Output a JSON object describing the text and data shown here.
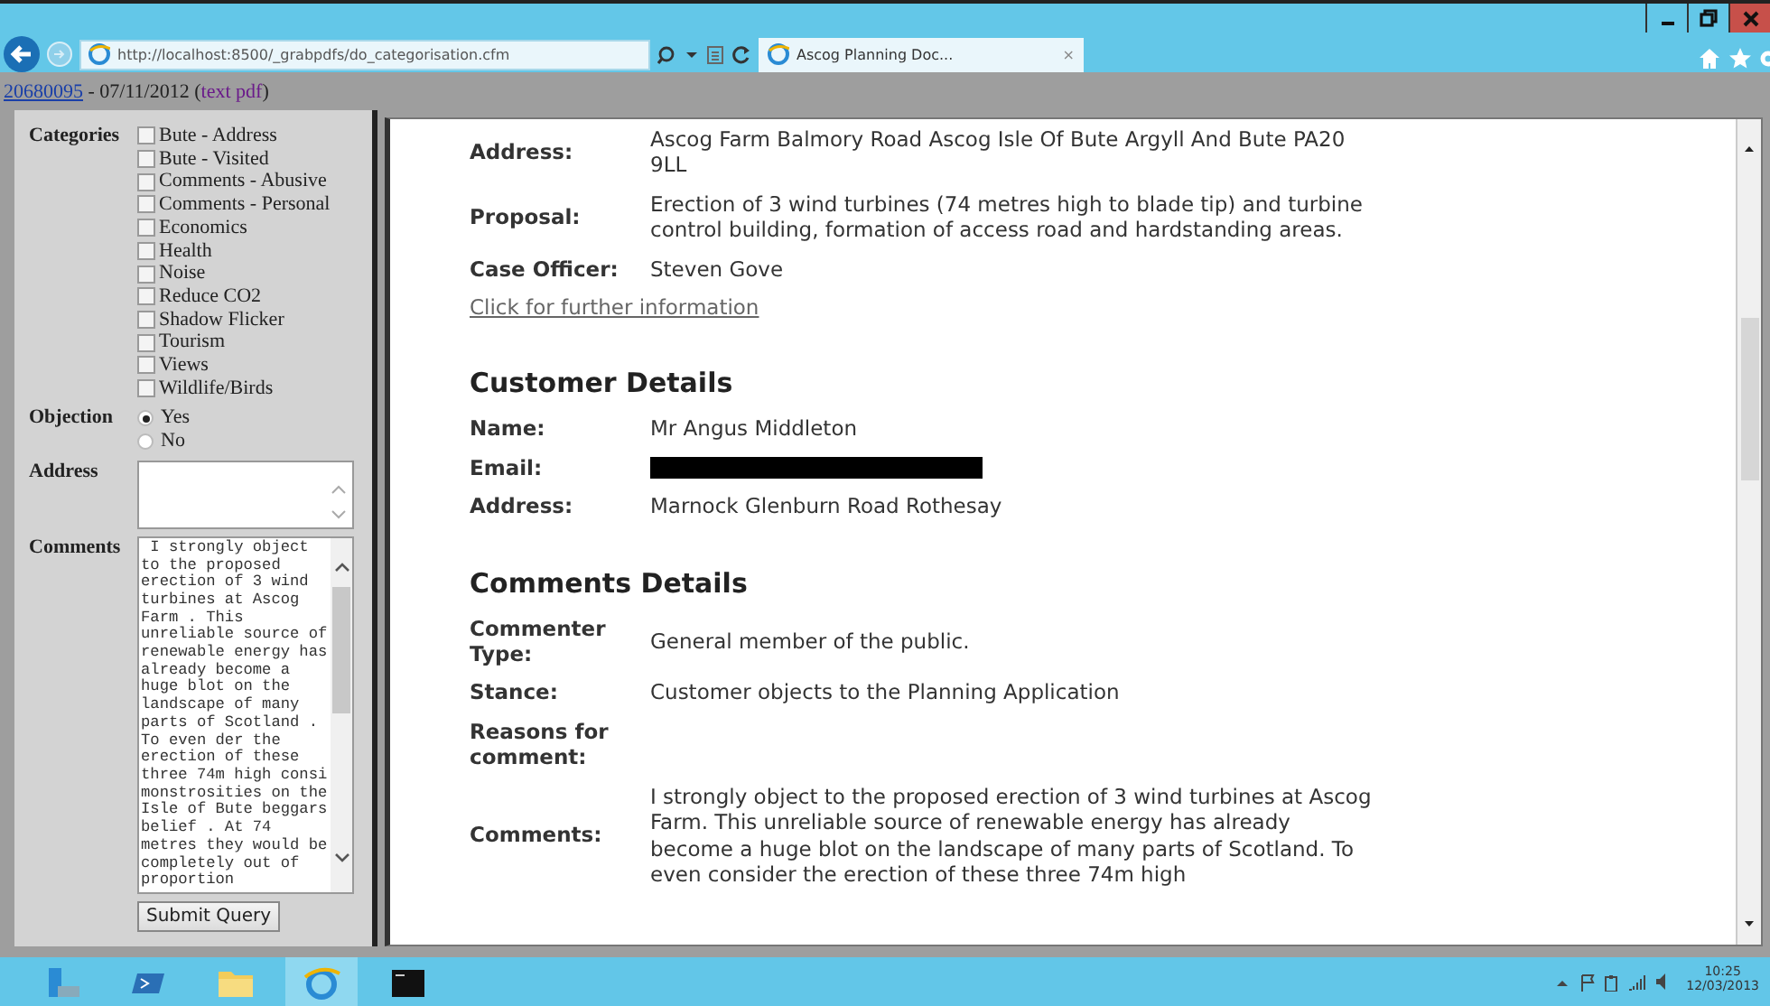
{
  "browser": {
    "url": "http://localhost:8500/_grabpdfs/do_categorisation.cfm",
    "tab": {
      "title": "Ascog Planning Doc...",
      "close": "×",
      "selected": true
    }
  },
  "record_line": [
    {
      "kind": "link",
      "text": "20680095"
    },
    {
      "kind": "text",
      "text": " - 07/11/2012 ("
    },
    {
      "kind": "visited_link",
      "text": "text pdf"
    },
    {
      "kind": "text",
      "text": ")"
    }
  ],
  "form": {
    "categories": {
      "label": "Categories",
      "items": [
        {
          "label": "Bute - Address",
          "checked": false
        },
        {
          "label": "Bute - Visited",
          "checked": false
        },
        {
          "label": "Comments - Abusive",
          "checked": false
        },
        {
          "label": "Comments - Personal",
          "checked": false
        },
        {
          "label": "Economics",
          "checked": false
        },
        {
          "label": "Health",
          "checked": false
        },
        {
          "label": "Noise",
          "checked": false
        },
        {
          "label": "Reduce CO2",
          "checked": false
        },
        {
          "label": "Shadow Flicker",
          "checked": false
        },
        {
          "label": "Tourism",
          "checked": false
        },
        {
          "label": "Views",
          "checked": false
        },
        {
          "label": "Wildlife/Birds",
          "checked": false
        }
      ]
    },
    "objection": {
      "label": "Objection",
      "options": [
        {
          "label": "Yes",
          "selected": true
        },
        {
          "label": "No",
          "selected": false
        }
      ]
    },
    "address": {
      "label": "Address"
    },
    "comments": {
      "label": "Comments",
      "value": " I strongly object to the proposed erection of 3 wind turbines at Ascog Farm . This unreliable source of renewable energy has already become a huge blot on the landscape of many parts of Scotland . To even der the erection of these three 74m high consi monstrosities on the Isle of Bute beggars belief . At 74 metres they would be completely out of proportion"
    },
    "submit": "Submit Query"
  },
  "details": [
    {
      "rows": [
        {
          "kind": "text",
          "label": "Address:",
          "value": "Ascog Farm Balmory Road Ascog Isle Of Bute Argyll And Bute PA20 9LL"
        },
        {
          "kind": "text",
          "label": "Proposal:",
          "value": "Erection of 3 wind turbines (74 metres high to blade tip) and turbine control building, formation of access road and hardstanding areas."
        },
        {
          "kind": "text",
          "label": "Case Officer:",
          "value": "Steven Gove"
        },
        {
          "kind": "link",
          "value": "Click for further information"
        }
      ]
    },
    {
      "heading": "Customer Details",
      "rows": [
        {
          "kind": "text",
          "label": "Name:",
          "value": "Mr Angus Middleton"
        },
        {
          "kind": "redacted",
          "label": "Email:"
        },
        {
          "kind": "text",
          "label": "Address:",
          "value": "Marnock Glenburn Road Rothesay"
        }
      ]
    },
    {
      "heading": "Comments Details",
      "rows": [
        {
          "kind": "text",
          "label": "Commenter Type:",
          "value": "General member of the public."
        },
        {
          "kind": "text",
          "label": "Stance:",
          "value": "Customer objects to the Planning Application"
        },
        {
          "kind": "text",
          "label": "Reasons for comment:"
        },
        {
          "kind": "text",
          "label": "Comments:",
          "value": "I strongly object to the proposed erection of 3 wind turbines at Ascog Farm. This unreliable source of renewable energy has already become a huge blot on the landscape of many parts of Scotland. To even consider the erection of these three 74m high"
        }
      ]
    }
  ],
  "taskbar": {
    "apps": [
      {
        "kind": "server",
        "selected": false
      },
      {
        "kind": "powershell",
        "selected": false
      },
      {
        "kind": "folder",
        "selected": false
      },
      {
        "kind": "browser",
        "selected": true
      },
      {
        "kind": "console",
        "selected": false
      }
    ],
    "time": "10:25",
    "date": "12/03/2013"
  }
}
